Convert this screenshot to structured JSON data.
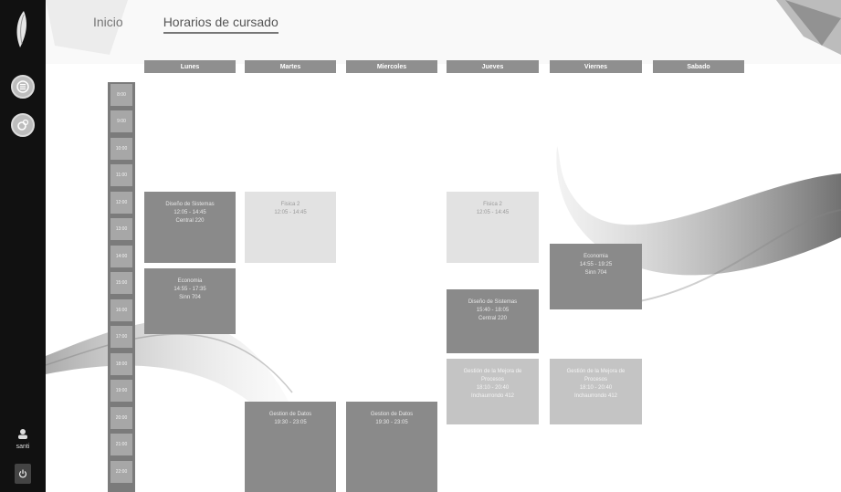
{
  "sidebar": {
    "user_name": "santi"
  },
  "nav": {
    "home": "Inicio",
    "schedule": "Horarios de cursado"
  },
  "days": [
    "Lunes",
    "Martes",
    "Miercoles",
    "Jueves",
    "Viernes",
    "Sabado"
  ],
  "hours": [
    "8:00",
    "9:00",
    "10:00",
    "11:00",
    "12:00",
    "13:00",
    "14:00",
    "15:00",
    "16:00",
    "17:00",
    "18:00",
    "19:00",
    "20:00",
    "21:00",
    "22:00"
  ],
  "blocks": [
    {
      "name": "Diseño de Sistemas",
      "time": "12:05 - 14:45",
      "room": "Central 220"
    },
    {
      "name": "Fisica 2",
      "time": "12:05 - 14:45",
      "room": ""
    },
    {
      "name": "Fisica 2",
      "time": "12:05 - 14:45",
      "room": ""
    },
    {
      "name": "Economia",
      "time": "14:55 - 17:35",
      "room": "Sinn 704"
    },
    {
      "name": "Economia",
      "time": "14:55 - 19:25",
      "room": "Sinn 704"
    },
    {
      "name": "Diseño de Sistemas",
      "time": "15:40 - 18:05",
      "room": "Central 220"
    },
    {
      "name": "Gestión de la Mejora de Procesos",
      "time": "18:10 - 20:40",
      "room": "Inchaurrondo 412"
    },
    {
      "name": "Gestión de la Mejora de Procesos",
      "time": "18:10 - 20:40",
      "room": "Inchaurrondo 412"
    },
    {
      "name": "Gestion de Datos",
      "time": "19:30 - 23:05",
      "room": ""
    },
    {
      "name": "Gestion de Datos",
      "time": "19:30 - 23:05",
      "room": ""
    }
  ]
}
